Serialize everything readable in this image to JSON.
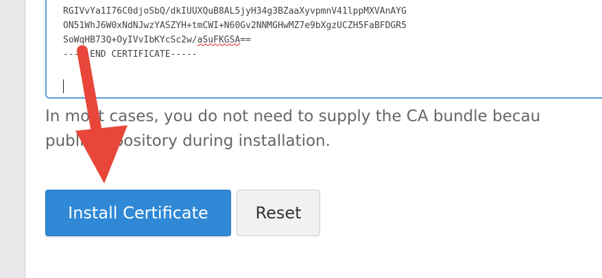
{
  "certificate": {
    "lines": [
      "RGIVvYa1I76C0djoSbQ/dkIUUXQuB8AL5jyH34g3BZaaXyvpmnV41lppMXVAnAYG",
      "ON51WhJ6W0xNdNJwzYASZYH+tmCWI+N60Gv2NNMGHwMZ7e9bXgzUCZH5FaBFDGR5",
      "SoWqHB73Q+OyIVvIbKYcSc2w/",
      "-----END CERTIFICATE-----"
    ],
    "line3_misspelled": "aSuFKGSA",
    "line3_end": "=="
  },
  "help": {
    "line1": "In most cases, you do not need to supply the CA bundle becau",
    "line2": "public repository during installation."
  },
  "buttons": {
    "install_label": "Install Certificate",
    "reset_label": "Reset"
  },
  "colors": {
    "primary": "#2f89d6",
    "focus_border": "#5b9bd5",
    "annotation_arrow": "#e8463a"
  },
  "icons": {
    "annotation": "red-arrow-annotation-icon"
  }
}
